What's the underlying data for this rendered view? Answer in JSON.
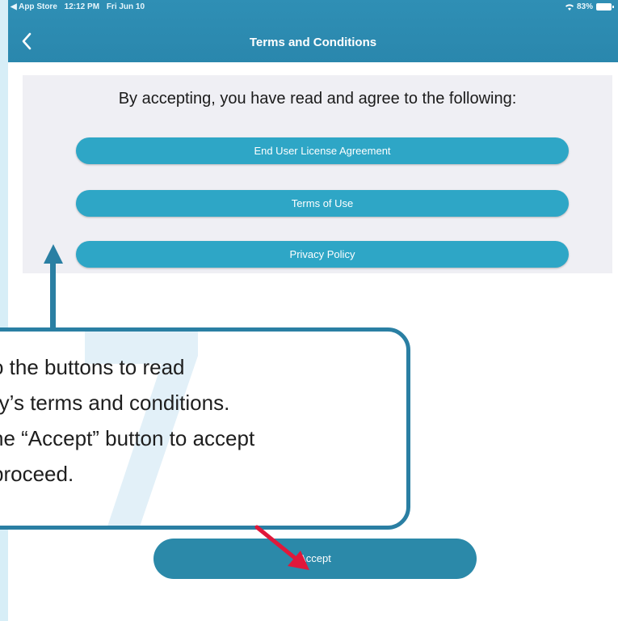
{
  "status_bar": {
    "back_app": "◀ App Store",
    "time": "12:12 PM",
    "date": "Fri Jun 10",
    "battery": "83%"
  },
  "navbar": {
    "title": "Terms and Conditions",
    "back_icon": "chevron-left-icon"
  },
  "main": {
    "heading": "By accepting, you have read and agree to the following:",
    "buttons": [
      {
        "label": "End User License Agreement"
      },
      {
        "label": "Terms of Use"
      },
      {
        "label": "Privacy Policy"
      }
    ],
    "accept_label": "Accept"
  },
  "callout": {
    "step_number": "7",
    "lines": [
      "o the buttons to read",
      "ry’s terms and conditions.",
      "he “Accept” button to accept",
      "proceed."
    ]
  },
  "colors": {
    "navbar": "#2f8fb5",
    "pill_button": "#2ea6c6",
    "accept_button": "#2b89a9",
    "callout_border": "#2a7fa3",
    "pointer_arrow": "#e0183a"
  }
}
